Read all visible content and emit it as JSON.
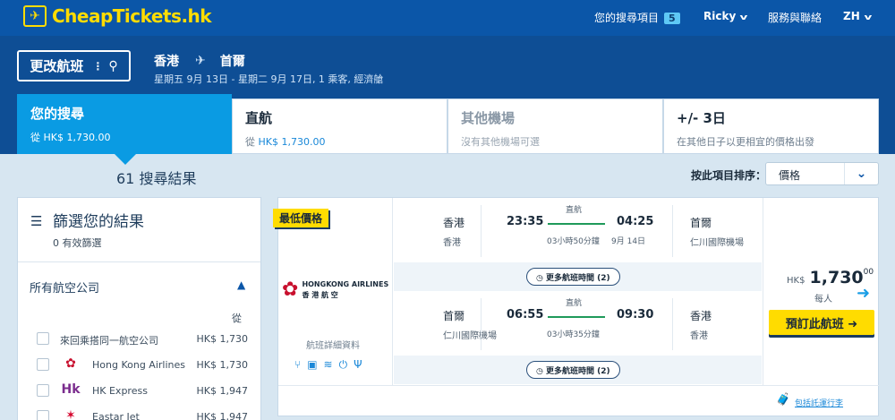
{
  "brand": {
    "name": "CheapTickets.hk",
    "logo_icon": "plane-icon",
    "color": "#ffdc00"
  },
  "topnav": {
    "searches_label": "您的搜尋項目",
    "searches_count": "5",
    "user": "Ricky",
    "service": "服務與聯絡",
    "lang": "ZH"
  },
  "search": {
    "change_label": "更改航班",
    "origin": "香港",
    "destination": "首爾",
    "details": "星期五 9月 13日 - 星期二 9月 17日, 1 乘客, 經濟艙"
  },
  "tabs": [
    {
      "title": "您的搜尋",
      "sub_prefix": "從",
      "sub_price": "HK$ 1,730.00"
    },
    {
      "title": "直航",
      "sub_prefix": "從",
      "sub_price": "HK$ 1,730.00"
    },
    {
      "title": "其他機場",
      "sub": "沒有其他機場可選"
    },
    {
      "title": "+/- 3日",
      "sub": "在其他日子以更相宜的價格出發"
    }
  ],
  "results": {
    "count_text": "61 搜尋結果"
  },
  "sort": {
    "label": "按此項目排序：",
    "value": "價格"
  },
  "filter": {
    "title": "篩選您的結果",
    "active": "0 有效篩選",
    "airlines_heading": "所有航空公司",
    "from_label": "從",
    "airlines": [
      {
        "name": "來回乘搭同一航空公司",
        "price": "HK$ 1,730",
        "icon": "none"
      },
      {
        "name": "Hong Kong Airlines",
        "price": "HK$ 1,730",
        "icon": "bauhinia-logo-icon"
      },
      {
        "name": "HK Express",
        "price": "HK$ 1,947",
        "icon": "hk-express-logo-icon"
      },
      {
        "name": "Eastar Jet",
        "price": "HK$ 1,947",
        "icon": "eastar-logo-icon"
      }
    ]
  },
  "flight": {
    "badge": "最低價格",
    "airline_en": "HONGKONG AIRLINES",
    "airline_zh": "香 港 航 空",
    "details_link": "航班詳細資料",
    "outbound": {
      "from_city": "香港",
      "from_airport": "香港",
      "dep": "23:35",
      "arr": "04:25",
      "stops": "直航",
      "duration": "03小時50分鐘",
      "arr_date": "9月 14日",
      "to_city": "首爾",
      "to_airport": "仁川國際機場",
      "more": "更多航班時間 (2)"
    },
    "inbound": {
      "from_city": "首爾",
      "from_airport": "仁川國際機場",
      "dep": "06:55",
      "arr": "09:30",
      "stops": "直航",
      "duration": "03小時35分鐘",
      "to_city": "香港",
      "to_airport": "香港",
      "more": "更多航班時間 (2)"
    },
    "price_currency": "HK$",
    "price_amount": "1,730",
    "price_cents": "00",
    "per_person": "每人",
    "book_label": "預訂此航班 ➜",
    "baggage": "包括託運行李"
  }
}
